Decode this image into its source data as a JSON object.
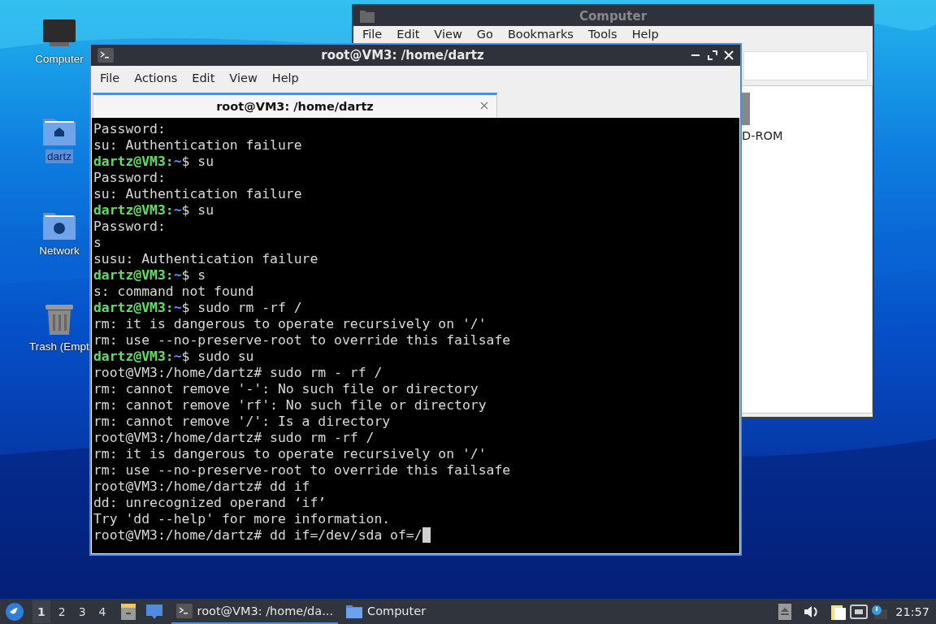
{
  "desktop_icons": [
    {
      "kind": "monitor",
      "label": "Computer",
      "selected": false
    },
    {
      "kind": "home",
      "label": "dartz",
      "selected": true
    },
    {
      "kind": "network",
      "label": "Network",
      "selected": false
    },
    {
      "kind": "trash",
      "label": "Trash (Empt",
      "selected": false
    }
  ],
  "file_manager": {
    "title": "Computer",
    "menu": [
      "File",
      "Edit",
      "View",
      "Go",
      "Bookmarks",
      "Tools",
      "Help"
    ],
    "items": [
      {
        "label": "D-ROM"
      }
    ]
  },
  "terminal": {
    "title": "root@VM3: /home/dartz",
    "menu": [
      "File",
      "Actions",
      "Edit",
      "View",
      "Help"
    ],
    "tab": "root@VM3: /home/dartz",
    "cursor": true,
    "lines": [
      {
        "kind": "output",
        "text": "Password:"
      },
      {
        "kind": "output",
        "text": "su: Authentication failure"
      },
      {
        "kind": "prompt",
        "user": "dartz@VM3:",
        "path": "~",
        "command": "$ su"
      },
      {
        "kind": "output",
        "text": "Password:"
      },
      {
        "kind": "output",
        "text": "su: Authentication failure"
      },
      {
        "kind": "prompt",
        "user": "dartz@VM3:",
        "path": "~",
        "command": "$ su"
      },
      {
        "kind": "output",
        "text": "Password:"
      },
      {
        "kind": "output",
        "text": "s"
      },
      {
        "kind": "output",
        "text": "susu: Authentication failure"
      },
      {
        "kind": "prompt",
        "user": "dartz@VM3:",
        "path": "~",
        "command": "$ s"
      },
      {
        "kind": "output",
        "text": "s: command not found"
      },
      {
        "kind": "prompt",
        "user": "dartz@VM3:",
        "path": "~",
        "command": "$ sudo rm -rf /"
      },
      {
        "kind": "output",
        "text": "rm: it is dangerous to operate recursively on '/'"
      },
      {
        "kind": "output",
        "text": "rm: use --no-preserve-root to override this failsafe"
      },
      {
        "kind": "prompt",
        "user": "dartz@VM3:",
        "path": "~",
        "command": "$ sudo su"
      },
      {
        "kind": "output",
        "text": "root@VM3:/home/dartz# sudo rm - rf /"
      },
      {
        "kind": "output",
        "text": "rm: cannot remove '-': No such file or directory"
      },
      {
        "kind": "output",
        "text": "rm: cannot remove 'rf': No such file or directory"
      },
      {
        "kind": "output",
        "text": "rm: cannot remove '/': Is a directory"
      },
      {
        "kind": "output",
        "text": "root@VM3:/home/dartz# sudo rm -rf /"
      },
      {
        "kind": "output",
        "text": "rm: it is dangerous to operate recursively on '/'"
      },
      {
        "kind": "output",
        "text": "rm: use --no-preserve-root to override this failsafe"
      },
      {
        "kind": "output",
        "text": "root@VM3:/home/dartz# dd if"
      },
      {
        "kind": "output",
        "text": "dd: unrecognized operand ‘if’"
      },
      {
        "kind": "output",
        "text": "Try 'dd --help' for more information."
      },
      {
        "kind": "output",
        "text": "root@VM3:/home/dartz# dd if=/dev/sda of=/"
      }
    ]
  },
  "taskbar": {
    "workspaces": [
      {
        "label": "1",
        "selected": true
      },
      {
        "label": "2",
        "selected": false
      },
      {
        "label": "3",
        "selected": false
      },
      {
        "label": "4",
        "selected": false
      }
    ],
    "tasks": [
      {
        "kind": "terminal",
        "label": "root@VM3: /home/da...",
        "selected": true
      },
      {
        "kind": "folder",
        "label": "Computer",
        "selected": false
      }
    ],
    "clock": "21:57"
  }
}
